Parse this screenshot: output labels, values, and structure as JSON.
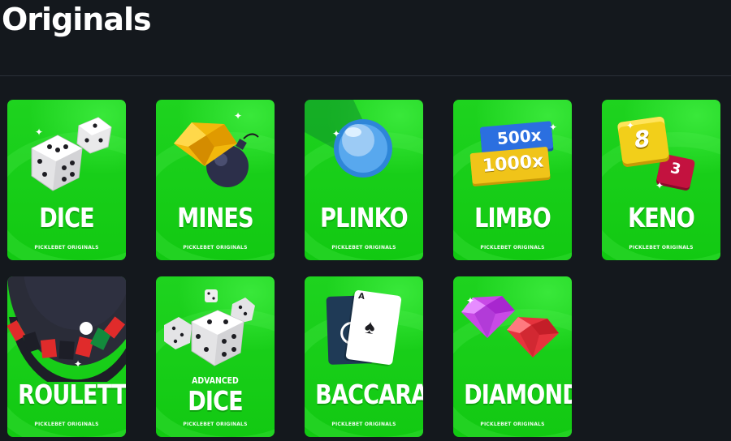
{
  "page": {
    "title": "Originals"
  },
  "games": [
    {
      "name": "DICE",
      "subtitle": "PICKLEBET ORIGINALS",
      "art": "dice-icon"
    },
    {
      "name": "MINES",
      "subtitle": "PICKLEBET ORIGINALS",
      "art": "gem-bomb-icon"
    },
    {
      "name": "PLINKO",
      "subtitle": "PICKLEBET ORIGINALS",
      "art": "ball-icon"
    },
    {
      "name": "LIMBO",
      "subtitle": "PICKLEBET ORIGINALS",
      "art": "multiplier-tags-icon",
      "tags": [
        "500x",
        "1000x"
      ]
    },
    {
      "name": "KENO",
      "subtitle": "PICKLEBET ORIGINALS",
      "art": "number-gems-icon",
      "numbers": [
        "8",
        "3"
      ]
    },
    {
      "name": "ROULETTE",
      "subtitle": "PICKLEBET ORIGINALS",
      "art": "roulette-wheel-icon"
    },
    {
      "name": "DICE",
      "prefix": "ADVANCED",
      "subtitle": "PICKLEBET ORIGINALS",
      "art": "dice-icon"
    },
    {
      "name": "BACCARAT",
      "subtitle": "PICKLEBET ORIGINALS",
      "art": "playing-cards-icon",
      "card_rank": "A"
    },
    {
      "name": "DIAMONDS",
      "subtitle": "PICKLEBET ORIGINALS",
      "art": "diamonds-icon"
    }
  ]
}
